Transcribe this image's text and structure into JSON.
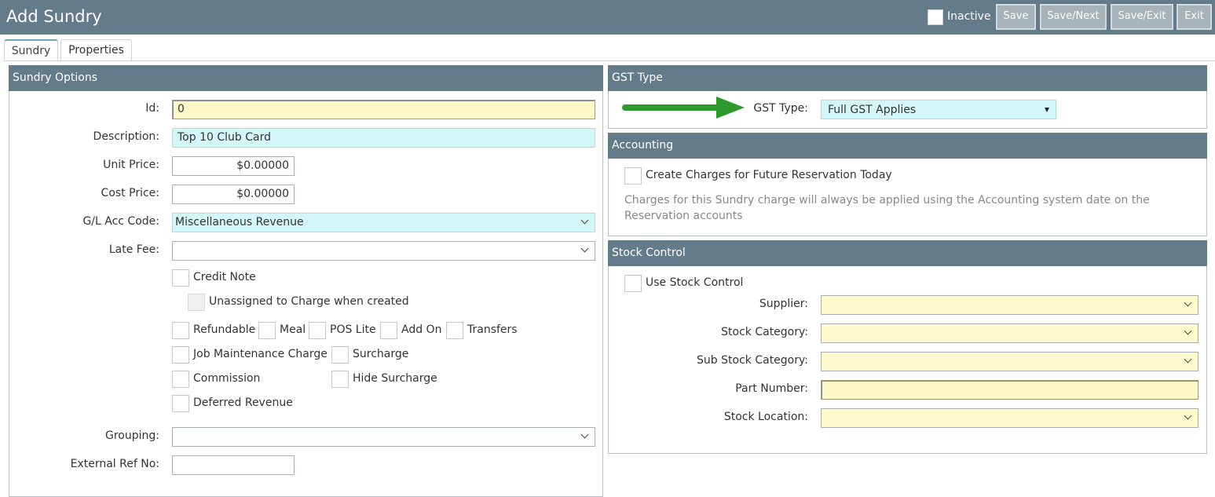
{
  "header": {
    "title": "Add Sundry",
    "inactive_label": "Inactive",
    "buttons": {
      "save": "Save",
      "save_next": "Save/Next",
      "save_exit": "Save/Exit",
      "exit": "Exit"
    }
  },
  "tabs": [
    {
      "label": "Sundry",
      "active": true
    },
    {
      "label": "Properties",
      "active": false
    }
  ],
  "sundry_options": {
    "heading": "Sundry Options",
    "id": {
      "label": "Id:",
      "value": "0"
    },
    "description": {
      "label": "Description:",
      "value": "Top 10 Club Card"
    },
    "unit_price": {
      "label": "Unit Price:",
      "value": "$0.00000"
    },
    "cost_price": {
      "label": "Cost Price:",
      "value": "$0.00000"
    },
    "gl_acc_code": {
      "label": "G/L Acc Code:",
      "value": "Miscellaneous Revenue"
    },
    "late_fee": {
      "label": "Late Fee:",
      "value": ""
    },
    "checkboxes": {
      "credit_note": "Credit Note",
      "unassigned": "Unassigned to Charge when created",
      "refundable": "Refundable",
      "meal": "Meal",
      "pos_lite": "POS Lite",
      "add_on": "Add On",
      "transfers": "Transfers",
      "job_maintenance": "Job Maintenance Charge",
      "surcharge": "Surcharge",
      "commission": "Commission",
      "hide_surcharge": "Hide Surcharge",
      "deferred_revenue": "Deferred Revenue"
    },
    "grouping": {
      "label": "Grouping:",
      "value": ""
    },
    "external_ref": {
      "label": "External Ref No:",
      "value": ""
    }
  },
  "gst": {
    "heading": "GST Type",
    "label": "GST Type:",
    "value": "Full GST Applies",
    "arrow_color": "#2e9a2e"
  },
  "accounting": {
    "heading": "Accounting",
    "checkbox_label": "Create Charges for Future Reservation Today",
    "note": "Charges for this Sundry charge will always be applied using the Accounting system date on the Reservation accounts"
  },
  "stock": {
    "heading": "Stock Control",
    "use_label": "Use Stock Control",
    "supplier": {
      "label": "Supplier:",
      "value": ""
    },
    "stock_category": {
      "label": "Stock Category:",
      "value": ""
    },
    "sub_stock_category": {
      "label": "Sub Stock Category:",
      "value": ""
    },
    "part_number": {
      "label": "Part Number:",
      "value": ""
    },
    "stock_location": {
      "label": "Stock Location:",
      "value": ""
    }
  },
  "colors": {
    "header_bg": "#647b8a",
    "button_bg": "#a6b3b8",
    "yellow_field": "#fffacd",
    "cyan_field": "#d3f6f8"
  }
}
